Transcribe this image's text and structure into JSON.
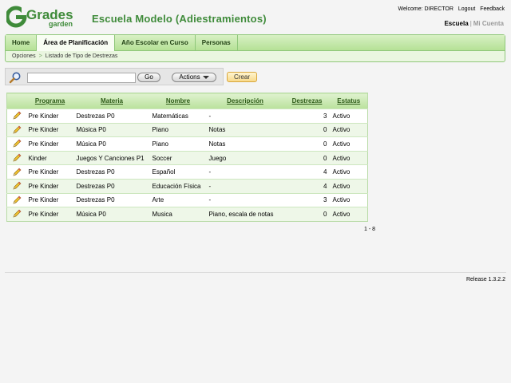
{
  "header": {
    "logo_text_main": "Grades",
    "logo_text_sub": "garden",
    "school_title": "Escuela Modelo (Adiestramientos)",
    "welcome": "Welcome: DIRECTOR",
    "logout_label": "Logout",
    "feedback_label": "Feedback",
    "school_link": "Escuela",
    "account_link": "Mi Cuenta",
    "separator": "|"
  },
  "nav": {
    "tabs": [
      {
        "label": "Home"
      },
      {
        "label": "Área de Planificación"
      },
      {
        "label": "Año Escolar en Curso"
      },
      {
        "label": "Personas"
      }
    ],
    "active_tab": "Área de Planificación",
    "breadcrumb": {
      "root": "Opciones",
      "current": "Listado de Tipo de Destrezas"
    }
  },
  "search": {
    "placeholder": "",
    "value": "",
    "go_label": "Go",
    "actions_label": "Actions",
    "icon": "search-magnifier-icon"
  },
  "create_label": "Crear",
  "table": {
    "columns": [
      "Programa",
      "Materia",
      "Nombre",
      "Descripción",
      "Destrezas",
      "Estatus"
    ],
    "rows": [
      {
        "programa": "Pre Kinder",
        "materia": "Destrezas P0",
        "nombre": "Matemáticas",
        "descripcion": "-",
        "destrezas": "3",
        "estatus": "Activo"
      },
      {
        "programa": "Pre Kinder",
        "materia": "Música P0",
        "nombre": "Piano",
        "descripcion": "Notas",
        "destrezas": "0",
        "estatus": "Activo"
      },
      {
        "programa": "Pre Kinder",
        "materia": "Música P0",
        "nombre": "Piano",
        "descripcion": "Notas",
        "destrezas": "0",
        "estatus": "Activo"
      },
      {
        "programa": "Kinder",
        "materia": "Juegos Y Canciones P1",
        "nombre": "Soccer",
        "descripcion": "Juego",
        "destrezas": "0",
        "estatus": "Activo"
      },
      {
        "programa": "Pre Kinder",
        "materia": "Destrezas P0",
        "nombre": "Español",
        "descripcion": "-",
        "destrezas": "4",
        "estatus": "Activo"
      },
      {
        "programa": "Pre Kinder",
        "materia": "Destrezas P0",
        "nombre": "Educación Física",
        "descripcion": "-",
        "destrezas": "4",
        "estatus": "Activo"
      },
      {
        "programa": "Pre Kinder",
        "materia": "Destrezas P0",
        "nombre": "Arte",
        "descripcion": "-",
        "destrezas": "3",
        "estatus": "Activo"
      },
      {
        "programa": "Pre Kinder",
        "materia": "Música P0",
        "nombre": "Musica",
        "descripcion": "Piano, escala de notas",
        "destrezas": "0",
        "estatus": "Activo"
      }
    ]
  },
  "pager": "1 - 8",
  "footer": {
    "release": "Release 1.3.2.2"
  },
  "colors": {
    "brand_green": "#3f8b3a",
    "tab_bg": "#b5e196",
    "row_alt": "#eef7e8",
    "create_button": "#f8d98a"
  }
}
